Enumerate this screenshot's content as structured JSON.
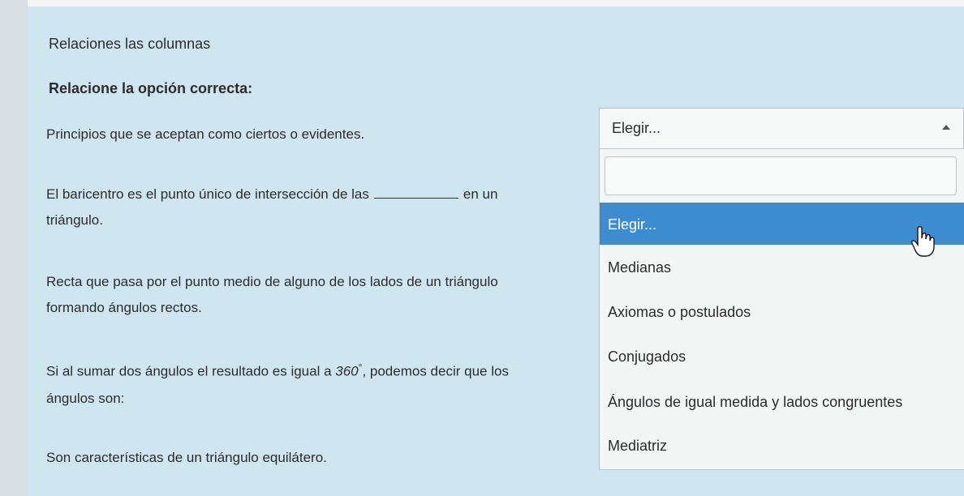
{
  "title": "Relaciones las columnas",
  "subtitle": "Relacione la opción correcta:",
  "questions": [
    {
      "line1": "Principios que se aceptan como ciertos o evidentes."
    },
    {
      "line1_a": "El baricentro es el punto único de intersección de las",
      "line1_b": "en un",
      "line2": "triángulo."
    },
    {
      "line1": "Recta que pasa por el punto medio de alguno de los lados de un triángulo",
      "line2": "formando ángulos rectos."
    },
    {
      "line1_a": "Si al sumar dos ángulos el resultado es igual a ",
      "line1_num": "360",
      "line1_deg": "°",
      "line1_b": ", podemos decir que los",
      "line2": "ángulos son:"
    },
    {
      "line1": "Son características de un triángulo equilátero."
    }
  ],
  "dropdown": {
    "selected_label": "Elegir...",
    "search_value": "",
    "options": [
      "Elegir...",
      "Medianas",
      "Axiomas o postulados",
      "Conjugados",
      "Ángulos de igual medida y lados congruentes",
      "Mediatriz"
    ]
  },
  "colors": {
    "panel": "#cfe5ef",
    "highlight": "#3d8bd0"
  }
}
